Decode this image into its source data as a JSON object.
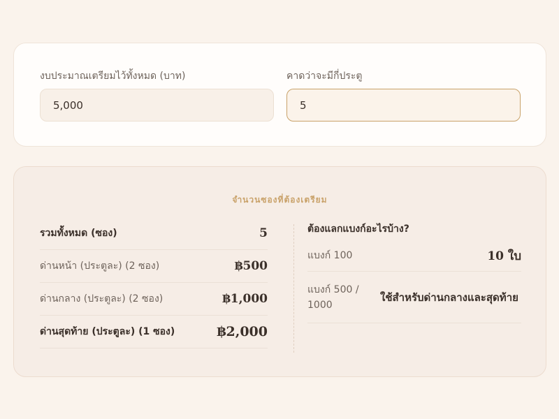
{
  "inputs": {
    "budget_label": "งบประมาณเตรียมไว้ทั้งหมด (บาท)",
    "budget_value": "5,000",
    "gates_label": "คาดว่าจะมีกี่ประตู",
    "gates_value": "5"
  },
  "result": {
    "title": "จำนวนซองที่ต้องเตรียม",
    "rows": [
      {
        "label": "รวมทั้งหมด (ซอง)",
        "value": "5"
      },
      {
        "label": "ด่านหน้า (ประตูละ) (2 ซอง)",
        "value": "฿500"
      },
      {
        "label": "ด่านกลาง (ประตูละ) (2 ซอง)",
        "value": "฿1,000"
      },
      {
        "label": "ด่านสุดท้าย (ประตูละ) (1 ซอง)",
        "value": "฿2,000"
      }
    ],
    "exchange_heading": "ต้องแลกแบงก์อะไรบ้าง?",
    "exchange": [
      {
        "label": "แบงก์ 100",
        "value": "10 ใบ"
      },
      {
        "label": "แบงก์ 500 / 1000",
        "value": "ใช้สำหรับด่านกลางและสุดท้าย"
      }
    ]
  },
  "colors": {
    "background": "#faf3ec",
    "accent": "#c9a26a",
    "text": "#3b302a"
  }
}
